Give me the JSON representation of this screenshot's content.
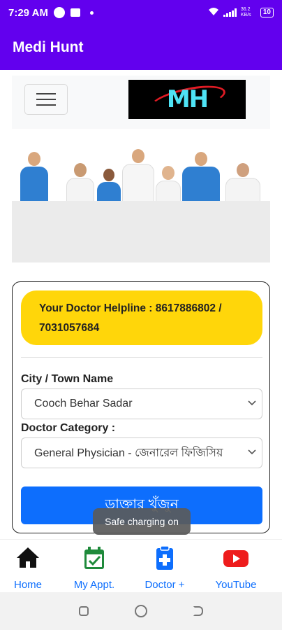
{
  "status_bar": {
    "time": "7:29 AM",
    "net_speed": "36.2 KB/s",
    "battery": "10"
  },
  "app_bar": {
    "title": "Medi Hunt"
  },
  "site_nav": {
    "logo_text": "MH"
  },
  "helpline": {
    "text": "Your Doctor Helpline : 8617886802 / 7031057684"
  },
  "form": {
    "city_label": "City / Town Name",
    "city_value": "Cooch Behar Sadar",
    "category_label": "Doctor Category :",
    "category_value": "General Physician - জেনারেল ফিজিসিয়",
    "search_button": "ডাক্তার খুঁজুন"
  },
  "toast": {
    "text": "Safe charging on"
  },
  "bottom_nav": {
    "items": [
      {
        "label": "Home",
        "icon": "home-icon"
      },
      {
        "label": "My Appt.",
        "icon": "calendar-check-icon"
      },
      {
        "label": "Doctor +",
        "icon": "clipboard-plus-icon"
      },
      {
        "label": "YouTube",
        "icon": "youtube-icon"
      }
    ]
  },
  "colors": {
    "app_bar": "#6200ee",
    "helpline_bg": "#ffd60a",
    "primary_button": "#0d6efd",
    "nav_link": "#0d6efd"
  }
}
